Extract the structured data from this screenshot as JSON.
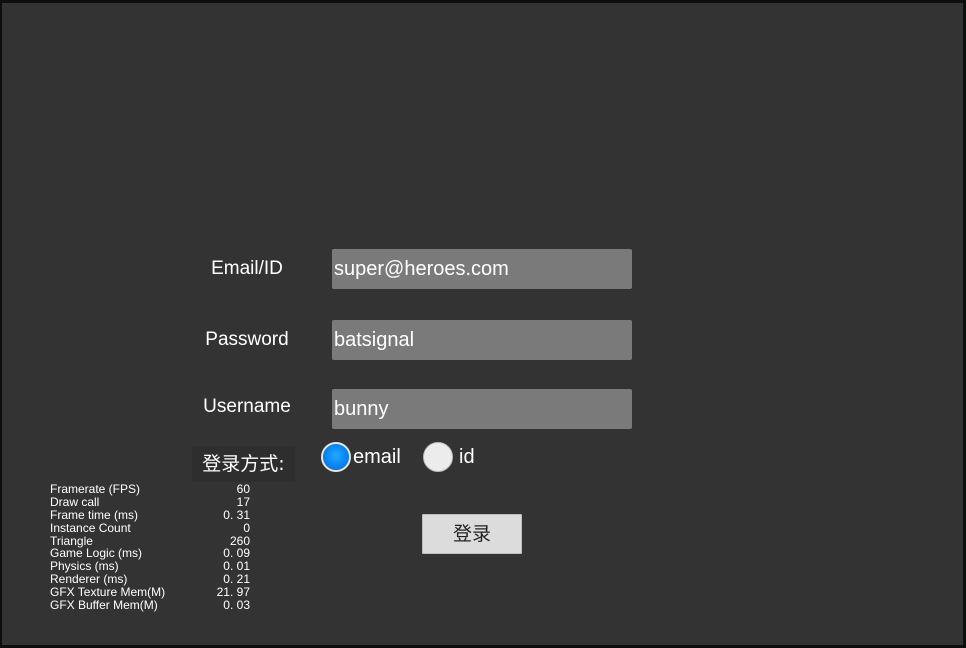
{
  "form": {
    "email_label": "Email/ID",
    "email_value": "super@heroes.com",
    "password_label": "Password",
    "password_value": "batsignal",
    "username_label": "Username",
    "username_value": "bunny",
    "login_mode_label": "登录方式:",
    "login_mode_options": [
      "email",
      "id"
    ],
    "login_mode_selected": "email",
    "login_button_label": "登录"
  },
  "stats": [
    {
      "name": "Framerate (FPS)",
      "value": "60"
    },
    {
      "name": "Draw call",
      "value": "17"
    },
    {
      "name": "Frame time (ms)",
      "value": "0. 31"
    },
    {
      "name": "Instance Count",
      "value": "0"
    },
    {
      "name": "Triangle",
      "value": "260"
    },
    {
      "name": "Game Logic (ms)",
      "value": "0. 09"
    },
    {
      "name": "Physics (ms)",
      "value": "0. 01"
    },
    {
      "name": "Renderer (ms)",
      "value": "0. 21"
    },
    {
      "name": "GFX Texture Mem(M)",
      "value": "21. 97"
    },
    {
      "name": "GFX Buffer Mem(M)",
      "value": "0. 03"
    }
  ],
  "colors": {
    "background": "#333333",
    "input_background": "#7a7a7a",
    "radio_selected": "#0a84f0",
    "button_background": "#dcdcdc"
  }
}
